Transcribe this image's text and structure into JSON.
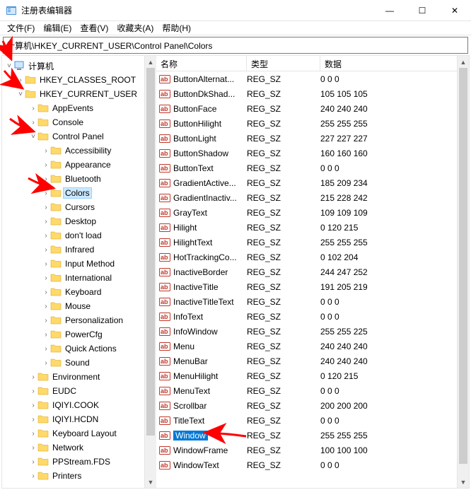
{
  "window": {
    "title": "注册表编辑器",
    "menu": [
      "文件(F)",
      "编辑(E)",
      "查看(V)",
      "收藏夹(A)",
      "帮助(H)"
    ],
    "win_buttons": {
      "min": "—",
      "max": "☐",
      "close": "✕"
    }
  },
  "address": "计算机\\HKEY_CURRENT_USER\\Control Panel\\Colors",
  "tree": {
    "root": "计算机",
    "hives": [
      {
        "name": "HKEY_CLASSES_ROOT",
        "expanded": false
      },
      {
        "name": "HKEY_CURRENT_USER",
        "expanded": true,
        "children": [
          {
            "name": "AppEvents",
            "expanded": false
          },
          {
            "name": "Console",
            "expanded": false
          },
          {
            "name": "Control Panel",
            "expanded": true,
            "children": [
              {
                "name": "Accessibility",
                "expanded": false
              },
              {
                "name": "Appearance",
                "expanded": false
              },
              {
                "name": "Bluetooth",
                "expanded": false
              },
              {
                "name": "Colors",
                "expanded": false,
                "selected": true
              },
              {
                "name": "Cursors",
                "expanded": false
              },
              {
                "name": "Desktop",
                "expanded": false
              },
              {
                "name": "don't load",
                "expanded": false
              },
              {
                "name": "Infrared",
                "expanded": false
              },
              {
                "name": "Input Method",
                "expanded": false
              },
              {
                "name": "International",
                "expanded": false
              },
              {
                "name": "Keyboard",
                "expanded": false
              },
              {
                "name": "Mouse",
                "expanded": false
              },
              {
                "name": "Personalization",
                "expanded": false
              },
              {
                "name": "PowerCfg",
                "expanded": false
              },
              {
                "name": "Quick Actions",
                "expanded": false
              },
              {
                "name": "Sound",
                "expanded": false
              }
            ]
          },
          {
            "name": "Environment",
            "expanded": false
          },
          {
            "name": "EUDC",
            "expanded": false
          },
          {
            "name": "IQIYI.COOK",
            "expanded": false
          },
          {
            "name": "IQIYI.HCDN",
            "expanded": false
          },
          {
            "name": "Keyboard Layout",
            "expanded": false
          },
          {
            "name": "Network",
            "expanded": false
          },
          {
            "name": "PPStream.FDS",
            "expanded": false
          },
          {
            "name": "Printers",
            "expanded": false
          }
        ]
      }
    ]
  },
  "list": {
    "columns": {
      "name": "名称",
      "type": "类型",
      "data": "数据"
    },
    "values": [
      {
        "name": "ButtonAlternat...",
        "type": "REG_SZ",
        "data": "0 0 0"
      },
      {
        "name": "ButtonDkShad...",
        "type": "REG_SZ",
        "data": "105 105 105"
      },
      {
        "name": "ButtonFace",
        "type": "REG_SZ",
        "data": "240 240 240"
      },
      {
        "name": "ButtonHilight",
        "type": "REG_SZ",
        "data": "255 255 255"
      },
      {
        "name": "ButtonLight",
        "type": "REG_SZ",
        "data": "227 227 227"
      },
      {
        "name": "ButtonShadow",
        "type": "REG_SZ",
        "data": "160 160 160"
      },
      {
        "name": "ButtonText",
        "type": "REG_SZ",
        "data": "0 0 0"
      },
      {
        "name": "GradientActive...",
        "type": "REG_SZ",
        "data": "185 209 234"
      },
      {
        "name": "GradientInactiv...",
        "type": "REG_SZ",
        "data": "215 228 242"
      },
      {
        "name": "GrayText",
        "type": "REG_SZ",
        "data": "109 109 109"
      },
      {
        "name": "Hilight",
        "type": "REG_SZ",
        "data": "0 120 215"
      },
      {
        "name": "HilightText",
        "type": "REG_SZ",
        "data": "255 255 255"
      },
      {
        "name": "HotTrackingCo...",
        "type": "REG_SZ",
        "data": "0 102 204"
      },
      {
        "name": "InactiveBorder",
        "type": "REG_SZ",
        "data": "244 247 252"
      },
      {
        "name": "InactiveTitle",
        "type": "REG_SZ",
        "data": "191 205 219"
      },
      {
        "name": "InactiveTitleText",
        "type": "REG_SZ",
        "data": "0 0 0"
      },
      {
        "name": "InfoText",
        "type": "REG_SZ",
        "data": "0 0 0"
      },
      {
        "name": "InfoWindow",
        "type": "REG_SZ",
        "data": "255 255 225"
      },
      {
        "name": "Menu",
        "type": "REG_SZ",
        "data": "240 240 240"
      },
      {
        "name": "MenuBar",
        "type": "REG_SZ",
        "data": "240 240 240"
      },
      {
        "name": "MenuHilight",
        "type": "REG_SZ",
        "data": "0 120 215"
      },
      {
        "name": "MenuText",
        "type": "REG_SZ",
        "data": "0 0 0"
      },
      {
        "name": "Scrollbar",
        "type": "REG_SZ",
        "data": "200 200 200"
      },
      {
        "name": "TitleText",
        "type": "REG_SZ",
        "data": "0 0 0"
      },
      {
        "name": "Window",
        "type": "REG_SZ",
        "data": "255 255 255",
        "selected": true
      },
      {
        "name": "WindowFrame",
        "type": "REG_SZ",
        "data": "100 100 100"
      },
      {
        "name": "WindowText",
        "type": "REG_SZ",
        "data": "0 0 0"
      }
    ]
  }
}
